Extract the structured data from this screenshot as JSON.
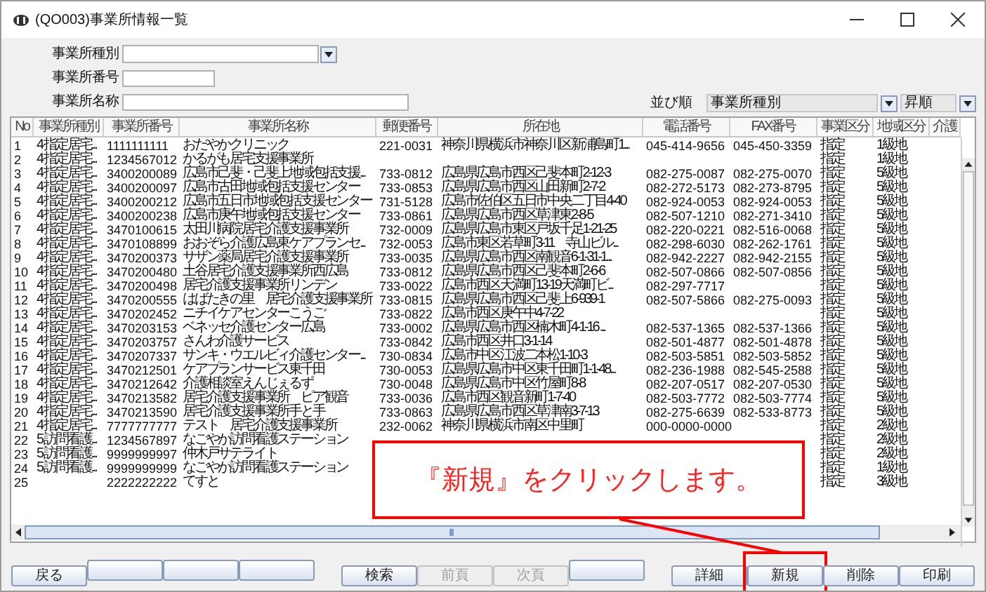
{
  "window": {
    "title": "(QO003)事業所情報一覧"
  },
  "filters": [
    {
      "label": "事業所種別",
      "kind": "combo"
    },
    {
      "label": "事業所番号",
      "kind": "short"
    },
    {
      "label": "事業所名称",
      "kind": "wide"
    }
  ],
  "sort": {
    "label": "並び順",
    "field": "事業所種別",
    "order": "昇順"
  },
  "table": {
    "columns": [
      "No",
      "事業所種別",
      "事業所番号",
      "事業所名称",
      "郵便番号",
      "所在地",
      "電話番号",
      "FAX番号",
      "事業区分",
      "地域区分",
      "介護"
    ],
    "rows": [
      [
        "1",
        "4 指定居宅...",
        "1111111111",
        "おだやかクリニック",
        "221-0031",
        "神奈川県横浜市神奈川区新浦島町1...",
        "045-414-9656",
        "045-450-3359",
        "指定",
        "1級地"
      ],
      [
        "2",
        "4 指定居宅...",
        "1234567012",
        "かるがも居宅支援事業所",
        null,
        null,
        null,
        null,
        "指定",
        "1級地"
      ],
      [
        "3",
        "4 指定居宅...",
        "3400200089",
        "広島市己斐・己斐上地域包括支援...",
        "733-0812",
        "広島県広島市西区己斐本町2-12-3",
        "082-275-0087",
        "082-275-0070",
        "指定",
        "5級地"
      ],
      [
        "4",
        "4 指定居宅...",
        "3400200097",
        "広島市古田地域包括支援センター",
        "733-0853",
        "広島県広島市西区山田新町2-7-2",
        "082-272-5173",
        "082-273-8795",
        "指定",
        "5級地"
      ],
      [
        "5",
        "4 指定居宅...",
        "3400200212",
        "広島市五日市地域包括支援センター",
        "731-5128",
        "広島市佐伯区五日市中央二丁目4-40",
        "082-924-0053",
        "082-924-0053",
        "指定",
        "5級地"
      ],
      [
        "6",
        "4 指定居宅...",
        "3400200238",
        "広島市庚午地域包括支援センター",
        "733-0861",
        "広島県広島市西区草津東2-8-5",
        "082-507-1210",
        "082-271-3410",
        "指定",
        "5級地"
      ],
      [
        "7",
        "4 指定居宅...",
        "3470100615",
        "太田川病院居宅介護支援事業所",
        "732-0009",
        "広島県広島市東区戸坂千足1-21-25",
        "082-220-0221",
        "082-516-0068",
        "指定",
        "5級地"
      ],
      [
        "8",
        "4 指定居宅...",
        "3470108899",
        "おおぞら介護広島東ケアプランセ...",
        "732-0053",
        "広島市東区若草町3-11　寺山ビル...",
        "082-298-6030",
        "082-262-1761",
        "指定",
        "5級地"
      ],
      [
        "9",
        "4 指定居宅...",
        "3470200373",
        "サザン薬局居宅介護支援事業所",
        "733-0035",
        "広島県広島市西区南観音6-1-31-1...",
        "082-942-2227",
        "082-942-2155",
        "指定",
        "5級地"
      ],
      [
        "10",
        "4 指定居宅...",
        "3470200480",
        "土谷居宅介護支援事業所西広島",
        "733-0812",
        "広島県広島市西区己斐本町2-6-6",
        "082-507-0866",
        "082-507-0856",
        "指定",
        "5級地"
      ],
      [
        "11",
        "4 指定居宅...",
        "3470200498",
        "居宅介護支援事業所リンデン",
        "733-0022",
        "広島市西区天満町13-19天満町ビ...",
        "082-297-7717",
        null,
        "指定",
        "5級地"
      ],
      [
        "12",
        "4 指定居宅...",
        "3470200555",
        "はばたきの里　居宅介護支援事業所",
        "733-0815",
        "広島県広島市西区己斐上6-939-1",
        "082-507-5866",
        "082-275-0093",
        "指定",
        "5級地"
      ],
      [
        "13",
        "4 指定居宅...",
        "3470202452",
        "ニチイケアセンターこうご",
        "733-0822",
        "広島市西区庚午中4-7-22",
        null,
        null,
        "指定",
        "5級地"
      ],
      [
        "14",
        "4 指定居宅...",
        "3470203153",
        "ベネッセ介護センター広島",
        "733-0002",
        "広島県広島市西区楠木町4-1-16 ...",
        "082-537-1365",
        "082-537-1366",
        "指定",
        "5級地"
      ],
      [
        "15",
        "4 指定居宅...",
        "3470203757",
        "さんわ介護サービス",
        "733-0842",
        "広島市西区井口3-1-14",
        "082-501-4877",
        "082-501-4878",
        "指定",
        "5級地"
      ],
      [
        "16",
        "4 指定居宅...",
        "3470207337",
        "サンキ・ウエルビィ介護センター...",
        "730-0834",
        "広島市中区江波二本松1-10-3",
        "082-503-5851",
        "082-503-5852",
        "指定",
        "5級地"
      ],
      [
        "17",
        "4 指定居宅...",
        "3470212501",
        "ケアプランサービス東千田",
        "730-0053",
        "広島県広島市中区東千田町1-1-48...",
        "082-236-1988",
        "082-545-2588",
        "指定",
        "5級地"
      ],
      [
        "18",
        "4 指定居宅...",
        "3470212642",
        "介護相談室えんじぇるず",
        "730-0048",
        "広島県広島市中区竹屋町8-8",
        "082-207-0517",
        "082-207-0530",
        "指定",
        "5級地"
      ],
      [
        "19",
        "4 指定居宅...",
        "3470213582",
        "居宅介護支援事業所　ピア観音",
        "733-0036",
        "広島市西区観音新町1-7-40",
        "082-503-7772",
        "082-503-7774",
        "指定",
        "5級地"
      ],
      [
        "20",
        "4 指定居宅...",
        "3470213590",
        "居宅介護支援事業所手と手",
        "733-0863",
        "広島県広島市西区草津南3-7-13",
        "082-275-6639",
        "082-533-8773",
        "指定",
        "5級地"
      ],
      [
        "21",
        "4 指定居宅...",
        "7777777777",
        "テスト　居宅介護支援事業所",
        "232-0062",
        "神奈川県横浜市南区中里町",
        "000-0000-0000",
        null,
        "指定",
        "2級地"
      ],
      [
        "22",
        "5 訪問看護...",
        "1234567897",
        "なごやか訪問看護ステーション",
        null,
        null,
        null,
        null,
        "指定",
        "2級地"
      ],
      [
        "23",
        "5 訪問看護...",
        "9999999997",
        "仲木戸サテライト",
        null,
        null,
        null,
        null,
        "指定",
        "2級地"
      ],
      [
        "24",
        "5 訪問看護...",
        "9999999999",
        "なごやか訪問看護ステーション",
        null,
        null,
        null,
        null,
        "指定",
        "1級地"
      ],
      [
        "25",
        null,
        "2222222222",
        "てすと",
        null,
        null,
        null,
        null,
        "指定",
        "3級地"
      ]
    ]
  },
  "button_groups": [
    [
      {
        "kind": "text",
        "label": "戻る",
        "disabled": false
      },
      {
        "kind": "blank"
      },
      {
        "kind": "blank"
      },
      {
        "kind": "blank"
      }
    ],
    [
      {
        "kind": "text",
        "label": "検索",
        "disabled": false
      },
      {
        "kind": "text",
        "label": "前頁",
        "disabled": true
      },
      {
        "kind": "text",
        "label": "次頁",
        "disabled": true
      },
      {
        "kind": "blank"
      }
    ],
    [
      {
        "kind": "text",
        "label": "詳細",
        "disabled": false
      },
      {
        "kind": "text",
        "label": "新規",
        "disabled": false,
        "highlight": true
      },
      {
        "kind": "text",
        "label": "削除",
        "disabled": false
      },
      {
        "kind": "text",
        "label": "印刷",
        "disabled": false
      }
    ]
  ],
  "annotation": {
    "text": "『新規』をクリックします。"
  }
}
